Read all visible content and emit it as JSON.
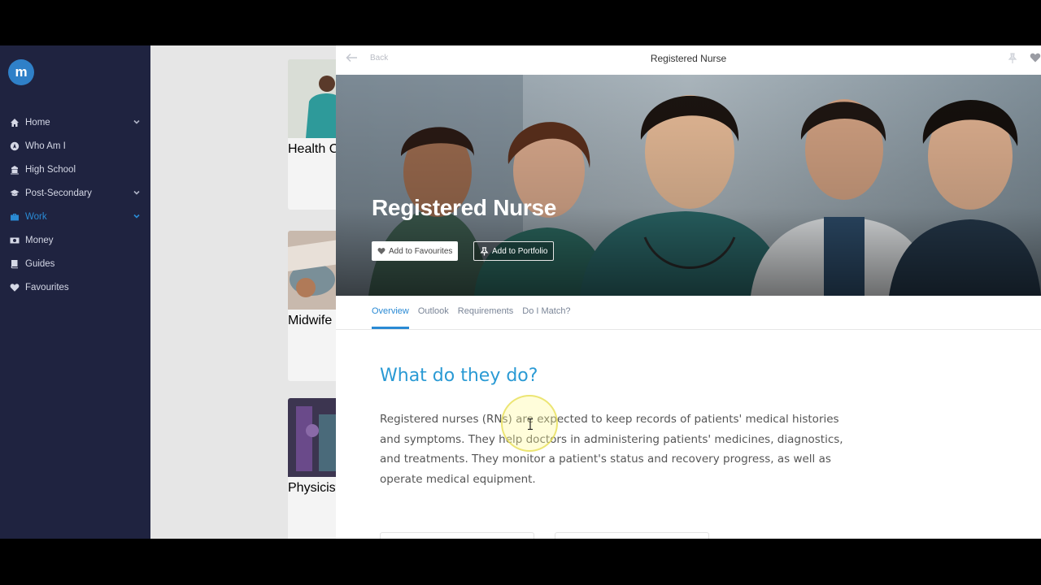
{
  "logo": {
    "letter": "m"
  },
  "sidebar": {
    "items": [
      {
        "label": "Home",
        "icon": "home-icon",
        "has_chevron": true
      },
      {
        "label": "Who Am I",
        "icon": "compass-icon",
        "has_chevron": false
      },
      {
        "label": "High School",
        "icon": "school-icon",
        "has_chevron": false
      },
      {
        "label": "Post-Secondary",
        "icon": "graduation-cap-icon",
        "has_chevron": true
      },
      {
        "label": "Work",
        "icon": "briefcase-icon",
        "has_chevron": true,
        "active": true
      },
      {
        "label": "Money",
        "icon": "money-icon",
        "has_chevron": false
      },
      {
        "label": "Guides",
        "icon": "book-icon",
        "has_chevron": false
      },
      {
        "label": "Favourites",
        "icon": "heart-icon",
        "has_chevron": false
      }
    ]
  },
  "listing": {
    "cards": [
      {
        "label": "Health C"
      },
      {
        "label": "Midwife"
      },
      {
        "label": "Physicist"
      }
    ]
  },
  "panel": {
    "back_label": "Back",
    "title": "Registered Nurse",
    "hero_title": "Registered Nurse",
    "add_favourites": "Add to Favourites",
    "add_portfolio": "Add to Portfolio",
    "tabs": [
      {
        "label": "Overview",
        "active": true
      },
      {
        "label": "Outlook"
      },
      {
        "label": "Requirements"
      },
      {
        "label": "Do I Match?"
      }
    ],
    "section_heading": "What do they do?",
    "section_text": "Registered nurses (RNs) are expected to keep records of patients' medical histories and symptoms. They help doctors in administering patients' medicines, diagnostics, and treatments. They monitor a patient's status and recovery progress, as well as operate medical equipment."
  },
  "colors": {
    "sidebar_bg": "#1f2340",
    "accent": "#2a8ad4",
    "heading": "#2a9ad4"
  }
}
